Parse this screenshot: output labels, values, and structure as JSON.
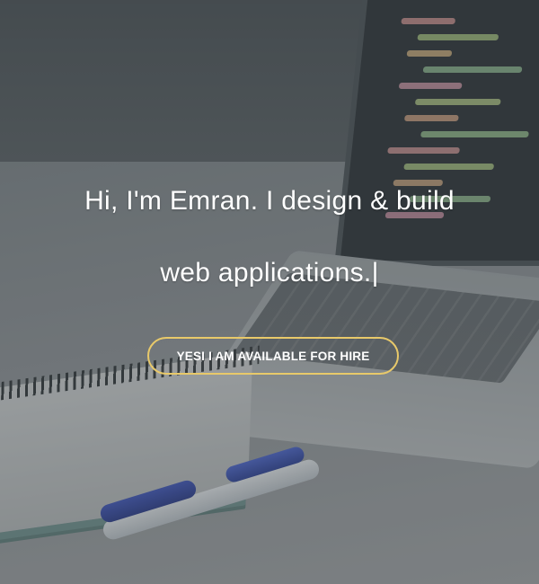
{
  "hero": {
    "headline_line1": "Hi, I'm Emran. I design & build",
    "headline_line2": "web applications.",
    "cursor": "|",
    "cta_label": "YESI I AM AVAILABLE FOR HIRE"
  },
  "colors": {
    "text": "#ffffff",
    "button_border": "#e8c96a",
    "overlay": "#3c4246"
  }
}
